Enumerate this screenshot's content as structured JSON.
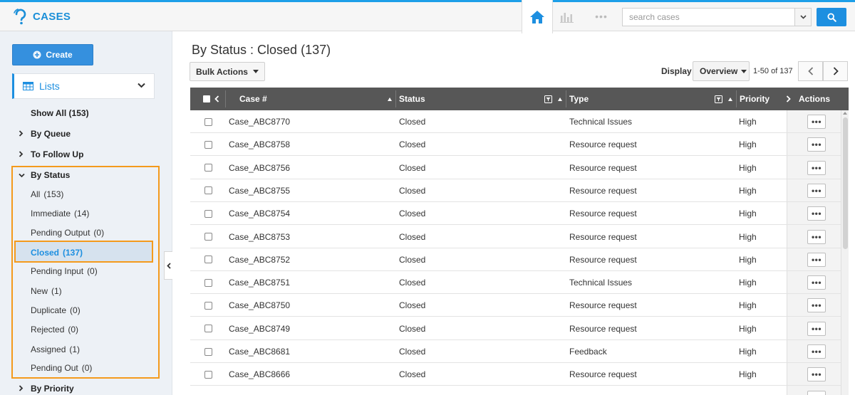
{
  "header": {
    "app_title": "CASES",
    "search_placeholder": "search cases",
    "more_label": "•••",
    "brand_color": "#1b8fd8"
  },
  "sidebar": {
    "create_label": "Create",
    "lists_label": "Lists",
    "show_all": "Show All (153)",
    "by_queue": "By Queue",
    "to_follow_up": "To Follow Up",
    "by_status": "By Status",
    "status_items": [
      {
        "label": "All",
        "count": "(153)"
      },
      {
        "label": "Immediate",
        "count": "(14)"
      },
      {
        "label": "Pending Output",
        "count": "(0)"
      },
      {
        "label": "Closed",
        "count": "(137)"
      },
      {
        "label": "Pending Input",
        "count": "(0)"
      },
      {
        "label": "New",
        "count": "(1)"
      },
      {
        "label": "Duplicate",
        "count": "(0)"
      },
      {
        "label": "Rejected",
        "count": "(0)"
      },
      {
        "label": "Assigned",
        "count": "(1)"
      },
      {
        "label": "Pending Out",
        "count": "(0)"
      }
    ],
    "by_priority": "By Priority",
    "highlight_color": "#f49a1c"
  },
  "main": {
    "title": "By Status : Closed (137)",
    "bulk_actions_label": "Bulk Actions",
    "display_label": "Display",
    "display_value": "Overview",
    "pager_text": "1-50 of 137"
  },
  "table": {
    "headers": {
      "case": "Case #",
      "status": "Status",
      "type": "Type",
      "priority": "Priority",
      "actions": "Actions"
    },
    "rows": [
      {
        "case": "Case_ABC8770",
        "status": "Closed",
        "type": "Technical Issues",
        "priority": "High"
      },
      {
        "case": "Case_ABC8758",
        "status": "Closed",
        "type": "Resource request",
        "priority": "High"
      },
      {
        "case": "Case_ABC8756",
        "status": "Closed",
        "type": "Resource request",
        "priority": "High"
      },
      {
        "case": "Case_ABC8755",
        "status": "Closed",
        "type": "Resource request",
        "priority": "High"
      },
      {
        "case": "Case_ABC8754",
        "status": "Closed",
        "type": "Resource request",
        "priority": "High"
      },
      {
        "case": "Case_ABC8753",
        "status": "Closed",
        "type": "Resource request",
        "priority": "High"
      },
      {
        "case": "Case_ABC8752",
        "status": "Closed",
        "type": "Resource request",
        "priority": "High"
      },
      {
        "case": "Case_ABC8751",
        "status": "Closed",
        "type": "Technical Issues",
        "priority": "High"
      },
      {
        "case": "Case_ABC8750",
        "status": "Closed",
        "type": "Resource request",
        "priority": "High"
      },
      {
        "case": "Case_ABC8749",
        "status": "Closed",
        "type": "Resource request",
        "priority": "High"
      },
      {
        "case": "Case_ABC8681",
        "status": "Closed",
        "type": "Feedback",
        "priority": "High"
      },
      {
        "case": "Case_ABC8666",
        "status": "Closed",
        "type": "Resource request",
        "priority": "High"
      }
    ],
    "row_action_label": "•••"
  }
}
